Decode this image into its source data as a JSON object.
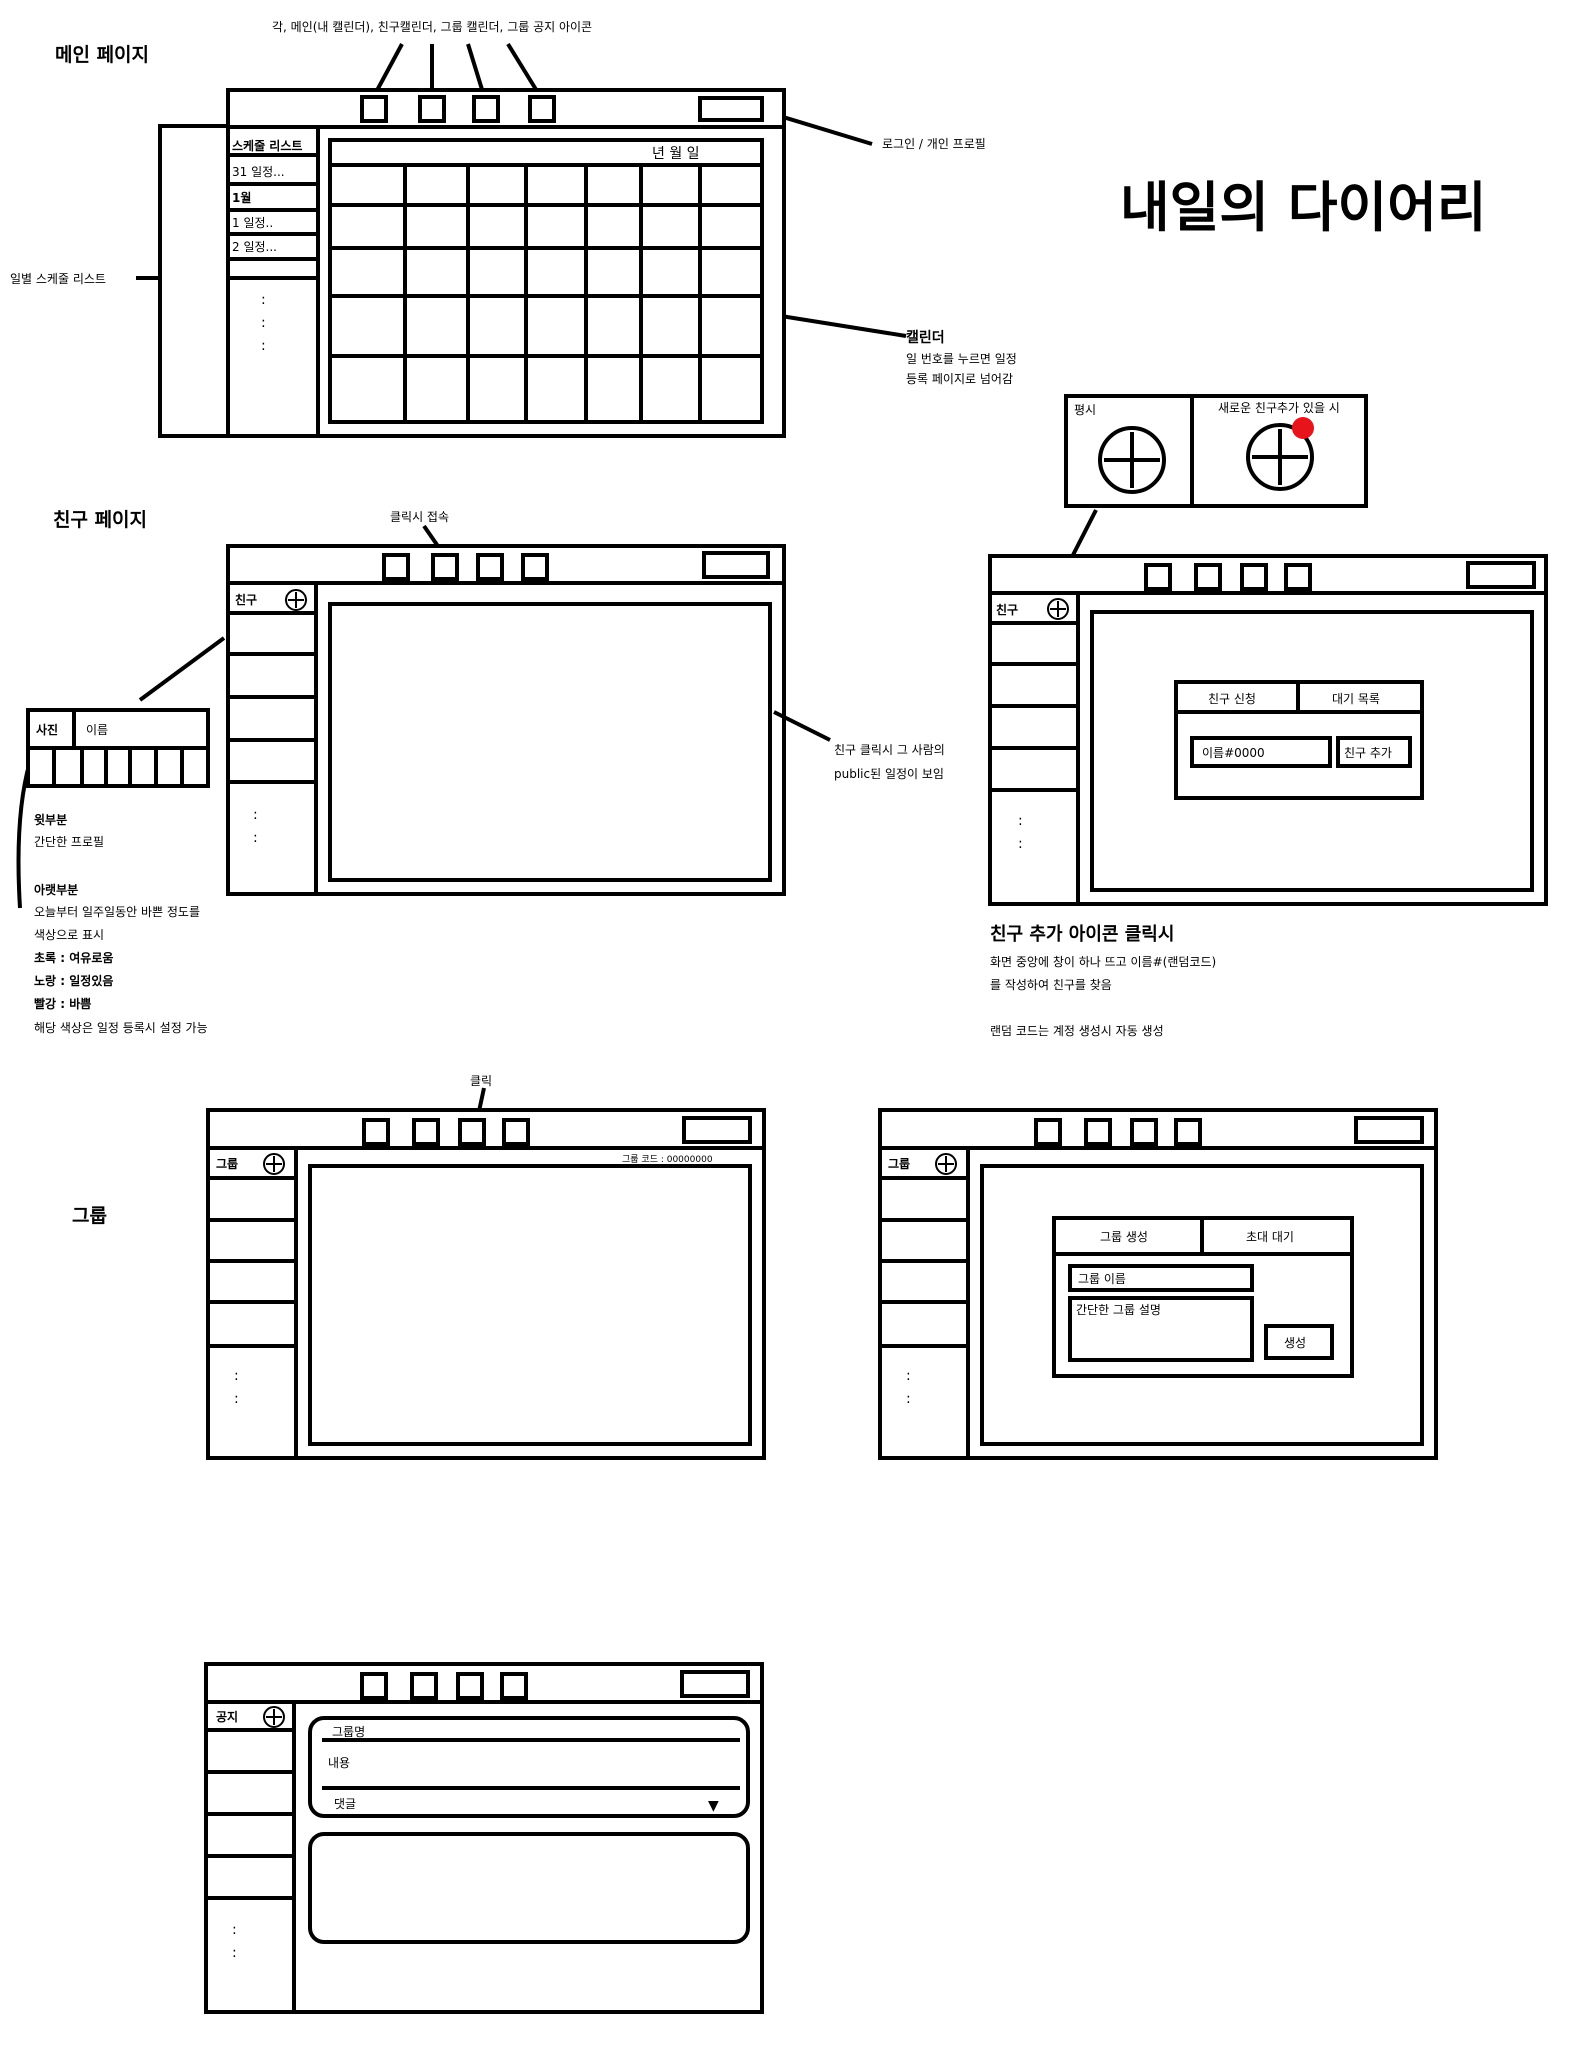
{
  "title": "내일의 다이어리",
  "sections": {
    "main": "메인 페이지",
    "friend": "친구 페이지",
    "group": "그룹"
  },
  "main_page": {
    "top_note": "각, 메인(내 캘린더), 친구캘린더, 그룹 캘린더, 그룹 공지 아이콘",
    "login_note": "로그인 / 개인 프로필",
    "list_header": "스케줄 리스트",
    "list_items": [
      "31 일정...",
      "1월",
      "1 일정..",
      "2 일정..."
    ],
    "ellipsis": ":",
    "left_note": "일별 스케줄 리스트",
    "calendar_header": "년 월 일",
    "calendar_note_title": "캘린더",
    "calendar_note_lines": [
      "일 번호를 누르면 일정",
      "등록 페이지로 넘어감"
    ]
  },
  "add_icons": {
    "normal": "평시",
    "new_friend": "새로운 친구추가 있을 시"
  },
  "friend_page": {
    "click_note": "클릭시 접속",
    "sidebar_label": "친구",
    "profile_photo": "사진",
    "profile_name": "이름",
    "right_note_lines": [
      "친구 클릭시 그 사람의",
      "public된 일정이 보임"
    ],
    "bottom_notes": [
      "윗부분",
      "간단한 프로필",
      "아랫부분",
      "오늘부터 일주일동안 바쁜 정도를",
      "색상으로 표시",
      "초록 : 여유로움",
      "노랑 : 일정있음",
      "빨강 : 바쁨",
      "해당 색상은 일정 등록시 설정 가능"
    ]
  },
  "friend_add": {
    "sidebar_label": "친구",
    "tab_request": "친구 신청",
    "tab_waiting": "대기 목록",
    "input_value": "이름#0000",
    "add_button": "친구 추가",
    "note_title": "친구 추가 아이콘 클릭시",
    "note_lines": [
      "화면 중앙에 창이 하나 뜨고 이름#(랜덤코드)",
      "를 작성하여 친구를 찾음",
      "",
      "랜덤 코드는 계정 생성시 자동 생성"
    ]
  },
  "group_page": {
    "click_note": "클릭",
    "sidebar_label": "그룹",
    "group_code": "그룹 코드 : 00000000"
  },
  "group_create": {
    "sidebar_label": "그룹",
    "tab_create": "그룹 생성",
    "tab_invite": "초대 대기",
    "name_field": "그룹 이름",
    "desc_field": "간단한 그룹 설명",
    "create_button": "생성"
  },
  "notice_page": {
    "sidebar_label": "공지",
    "group_name": "그룹명",
    "content": "내용",
    "comment": "댓글",
    "dropdown_glyph": "▼"
  },
  "colors": {
    "stroke": "#000000",
    "background": "#ffffff",
    "notification_dot": "#e8141c"
  }
}
